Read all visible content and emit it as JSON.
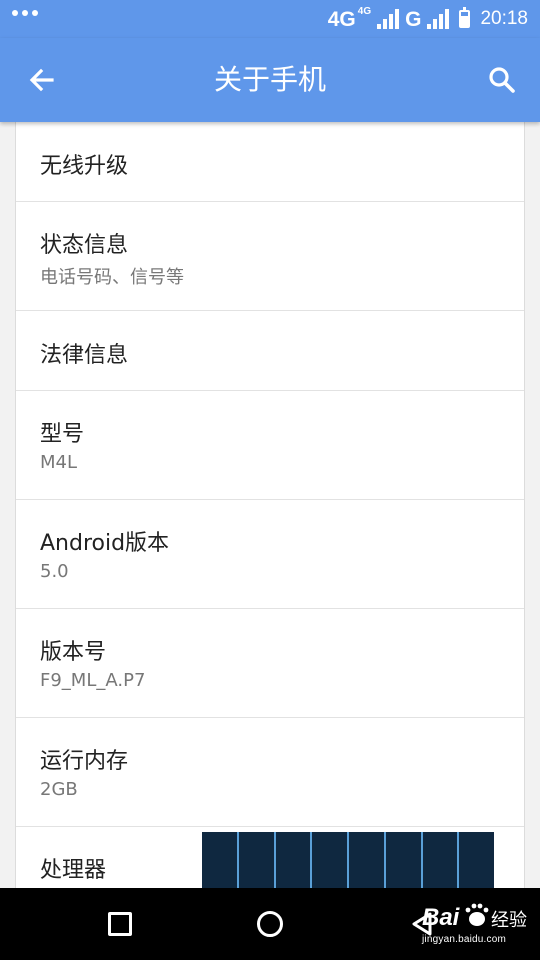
{
  "status_bar": {
    "network_type": "4G",
    "network_superscript": "4G",
    "network_type_2": "G",
    "time": "20:18"
  },
  "app_bar": {
    "title": "关于手机",
    "back_icon": "arrow-back-icon",
    "search_icon": "search-icon"
  },
  "list": {
    "items": [
      {
        "title": "无线升级",
        "subtitle": ""
      },
      {
        "title": "状态信息",
        "subtitle": "电话号码、信号等"
      },
      {
        "title": "法律信息",
        "subtitle": ""
      },
      {
        "title": "型号",
        "subtitle": "M4L"
      },
      {
        "title": "Android版本",
        "subtitle": "5.0"
      },
      {
        "title": "版本号",
        "subtitle": "F9_ML_A.P7"
      },
      {
        "title": "运行内存",
        "subtitle": "2GB"
      },
      {
        "title": "处理器",
        "subtitle": ""
      }
    ]
  },
  "nav_bar": {
    "recents_icon": "recents-square-icon",
    "home_icon": "home-circle-icon",
    "back_icon": "back-triangle-icon"
  },
  "watermark": {
    "logo_text": "Bai 经验",
    "url": "jingyan.baidu.com"
  },
  "colors": {
    "accent": "#5f97ea",
    "list_bg": "#ffffff",
    "page_bg": "#f2f2f2",
    "primary_text": "#222222",
    "secondary_text": "#777777"
  }
}
